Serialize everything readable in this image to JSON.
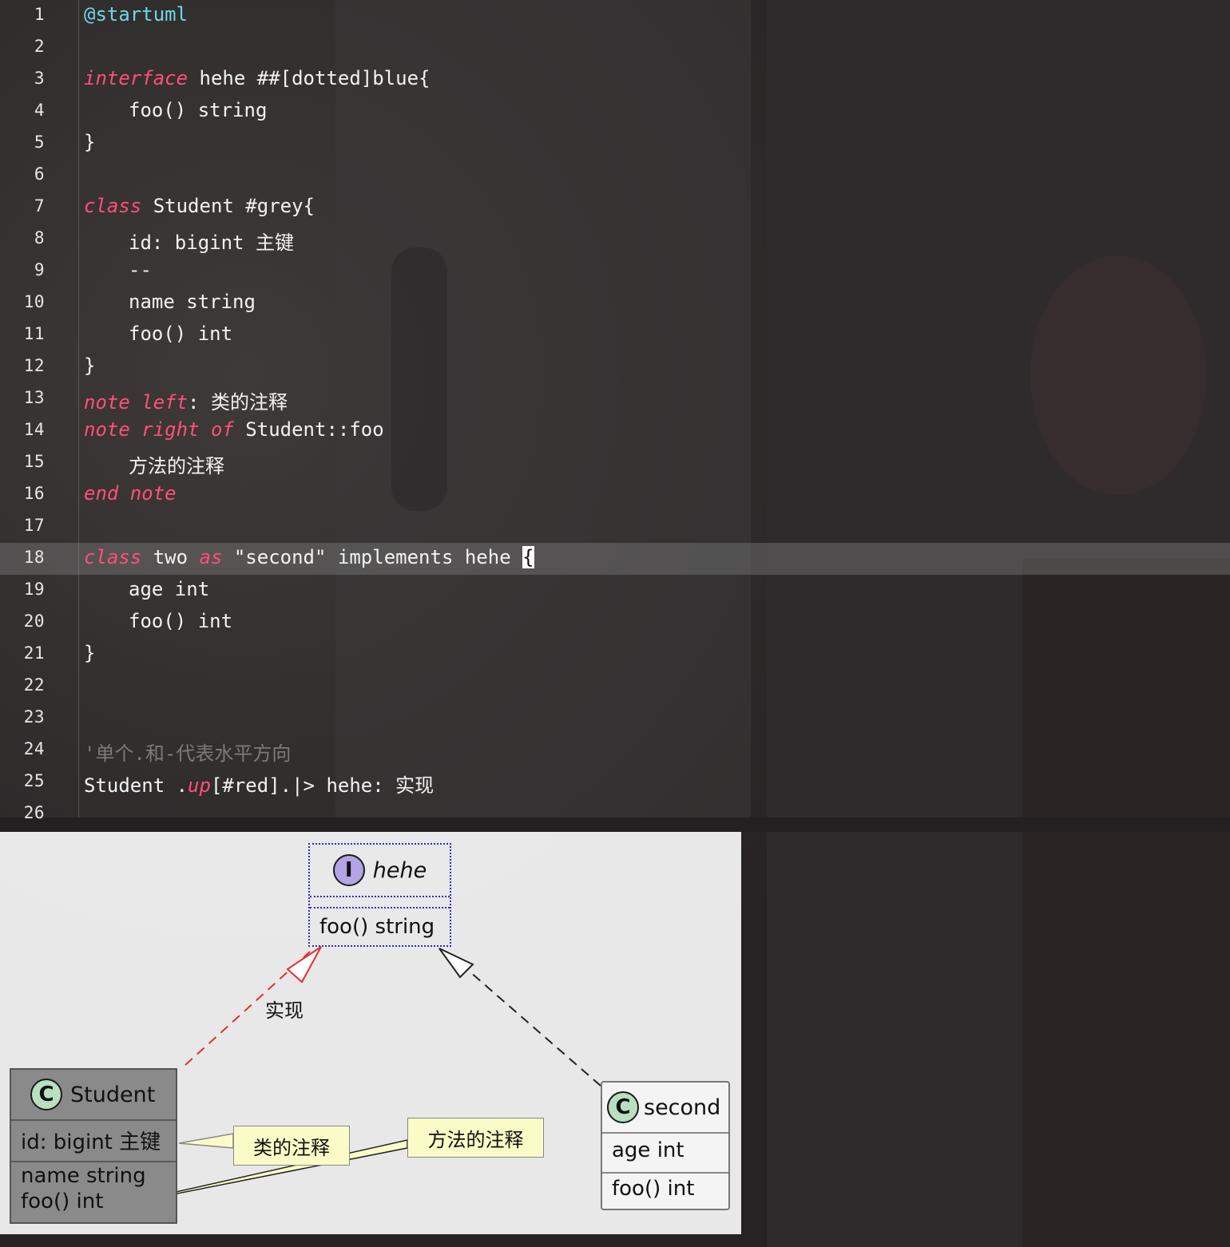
{
  "editor": {
    "lines": [
      {
        "n": "1",
        "parts": [
          {
            "t": "@startuml",
            "c": "dir"
          }
        ]
      },
      {
        "n": "2",
        "parts": []
      },
      {
        "n": "3",
        "parts": [
          {
            "t": "interface",
            "c": "kw"
          },
          {
            "t": " hehe ##[dotted]blue{"
          }
        ]
      },
      {
        "n": "4",
        "indent": true,
        "parts": [
          {
            "t": "foo() string"
          }
        ]
      },
      {
        "n": "5",
        "parts": [
          {
            "t": "}"
          }
        ]
      },
      {
        "n": "6",
        "parts": []
      },
      {
        "n": "7",
        "parts": [
          {
            "t": "class",
            "c": "kw"
          },
          {
            "t": " Student #grey{"
          }
        ]
      },
      {
        "n": "8",
        "indent": true,
        "parts": [
          {
            "t": "id: bigint 主键"
          }
        ]
      },
      {
        "n": "9",
        "indent": true,
        "parts": [
          {
            "t": "--"
          }
        ]
      },
      {
        "n": "10",
        "indent": true,
        "parts": [
          {
            "t": "name string"
          }
        ]
      },
      {
        "n": "11",
        "indent": true,
        "parts": [
          {
            "t": "foo() int"
          }
        ]
      },
      {
        "n": "12",
        "parts": [
          {
            "t": "}"
          }
        ]
      },
      {
        "n": "13",
        "parts": [
          {
            "t": "note left",
            "c": "kw"
          },
          {
            "t": ": 类的注释"
          }
        ]
      },
      {
        "n": "14",
        "parts": [
          {
            "t": "note right of",
            "c": "kw"
          },
          {
            "t": " Student::foo"
          }
        ]
      },
      {
        "n": "15",
        "indent": true,
        "parts": [
          {
            "t": "方法的注释"
          }
        ]
      },
      {
        "n": "16",
        "parts": [
          {
            "t": "end note",
            "c": "kw"
          }
        ]
      },
      {
        "n": "17",
        "parts": []
      },
      {
        "n": "18",
        "active": true,
        "parts": [
          {
            "t": "class",
            "c": "kw"
          },
          {
            "t": " two "
          },
          {
            "t": "as",
            "c": "kw"
          },
          {
            "t": " \"second\" implements hehe "
          },
          {
            "t": "{",
            "c": "caret"
          }
        ]
      },
      {
        "n": "19",
        "indent": true,
        "parts": [
          {
            "t": "age int"
          }
        ]
      },
      {
        "n": "20",
        "indent": true,
        "parts": [
          {
            "t": "foo() int"
          }
        ]
      },
      {
        "n": "21",
        "parts": [
          {
            "t": "}"
          }
        ]
      },
      {
        "n": "22",
        "parts": []
      },
      {
        "n": "23",
        "parts": []
      },
      {
        "n": "24",
        "parts": [
          {
            "t": "'单个.和-代表水平方向",
            "c": "cm"
          }
        ]
      },
      {
        "n": "25",
        "parts": [
          {
            "t": "Student ."
          },
          {
            "t": "up",
            "c": "kw"
          },
          {
            "t": "[#red].|> hehe: 实现"
          }
        ]
      },
      {
        "n": "26",
        "parts": []
      }
    ]
  },
  "diagram": {
    "interface": {
      "stereotype": "I",
      "name": "hehe",
      "members": [
        "foo() string"
      ]
    },
    "student": {
      "stereotype": "C",
      "name": "Student",
      "fields": [
        "id: bigint 主键"
      ],
      "methods": [
        "name string",
        "foo() int"
      ]
    },
    "second": {
      "stereotype": "C",
      "name": "second",
      "fields": [
        "age int"
      ],
      "methods": [
        "foo() int"
      ]
    },
    "notes": [
      "类的注释",
      "方法的注释"
    ],
    "edge_label": "实现",
    "colors": {
      "interface_border": "#2b2bd6",
      "student_bg": "#8a8a8a",
      "red_arrow": "#e03030",
      "note_bg": "#fbfbc8"
    }
  }
}
